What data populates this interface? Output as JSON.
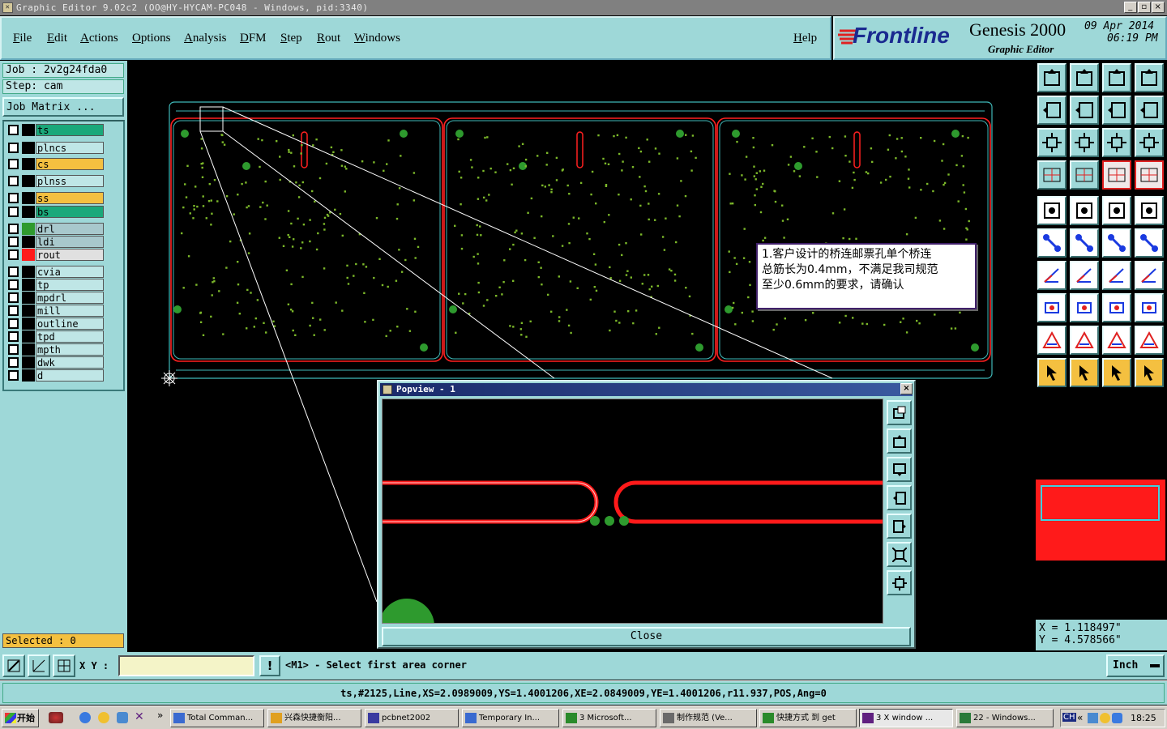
{
  "window": {
    "title": "Graphic Editor 9.02c2 (OO@HY-HYCAM-PC048 - Windows, pid:3340)",
    "minimize_glyph": "_",
    "restore_glyph": "▫",
    "close_glyph": "×"
  },
  "menu": {
    "items": [
      "File",
      "Edit",
      "Actions",
      "Options",
      "Analysis",
      "DFM",
      "Step",
      "Rout",
      "Windows"
    ],
    "help": "Help"
  },
  "brand": {
    "logo": "Frontline",
    "product": "Genesis 2000",
    "subtitle": "Graphic Editor",
    "date": "09 Apr 2014",
    "time": "06:19 PM"
  },
  "job": {
    "job_label": "Job : 2v2g24fda0",
    "step_label": "Step: cam",
    "matrix_button": "Job Matrix ..."
  },
  "layers": [
    {
      "name": "ts",
      "color": "#1aa87a",
      "swatch": "#000"
    },
    {
      "name": "plncs",
      "color": "#bfe6e6",
      "swatch": "#000"
    },
    {
      "name": "cs",
      "color": "#f4c040",
      "swatch": "#000"
    },
    {
      "name": "plnss",
      "color": "#bfe6e6",
      "swatch": "#000"
    },
    {
      "name": "ss",
      "color": "#f4c040",
      "swatch": "#000"
    },
    {
      "name": "bs",
      "color": "#1aa87a",
      "swatch": "#000"
    },
    {
      "name": "drl",
      "color": "#a8c8cc",
      "swatch": "#2e9a2e"
    },
    {
      "name": "ldi",
      "color": "#a8c8cc",
      "swatch": "#000"
    },
    {
      "name": "rout",
      "color": "#e0e0e0",
      "swatch": "#ff1a1a"
    },
    {
      "name": "cvia",
      "color": "#bfe6e6",
      "swatch": "#000"
    },
    {
      "name": "tp",
      "color": "#bfe6e6",
      "swatch": "#000"
    },
    {
      "name": "mpdrl",
      "color": "#bfe6e6",
      "swatch": "#000"
    },
    {
      "name": "mill",
      "color": "#bfe6e6",
      "swatch": "#000"
    },
    {
      "name": "outline",
      "color": "#bfe6e6",
      "swatch": "#000"
    },
    {
      "name": "tpd",
      "color": "#bfe6e6",
      "swatch": "#000"
    },
    {
      "name": "mpth",
      "color": "#bfe6e6",
      "swatch": "#000"
    },
    {
      "name": "dwk",
      "color": "#bfe6e6",
      "swatch": "#000"
    },
    {
      "name": "d",
      "color": "#bfe6e6",
      "swatch": "#000"
    }
  ],
  "selected_label": "Selected : 0",
  "annotation": {
    "line1": "1.客户设计的桥连邮票孔单个桥连",
    "line2": "总筋长为0.4mm，不满足我司规范",
    "line3": "至少0.6mm的要求，请确认"
  },
  "popview": {
    "title": "Popview - 1",
    "close_button": "Close",
    "close_glyph": "×"
  },
  "coords": {
    "x": "X  =  1.118497\"",
    "y": "Y  =  4.578566\""
  },
  "command": {
    "xy_label": "X Y :",
    "xy_value": "",
    "warn_glyph": "!",
    "prompt": "<M1> - Select first area corner",
    "units": "Inch"
  },
  "status_line": "ts,#2125,Line,XS=2.0989009,YS=1.4001206,XE=2.0849009,YE=1.4001206,r11.937,POS,Ang=0",
  "taskbar": {
    "start": "开始",
    "more": "»",
    "tasks": [
      "Total Comman...",
      "兴森快捷衡阳...",
      "pcbnet2002",
      "Temporary In...",
      "3 Microsoft...",
      "制作规范  (Ve...",
      "快捷方式 到 get",
      "3 X window ...",
      "22 - Windows..."
    ],
    "tray_more": "«",
    "clock": "18:25",
    "lang": "CH"
  },
  "colors": {
    "panel": "#9ed8d8",
    "rout": "#ff1a1a",
    "drill": "#2e9a2e",
    "outline": "#3fb8b8"
  }
}
